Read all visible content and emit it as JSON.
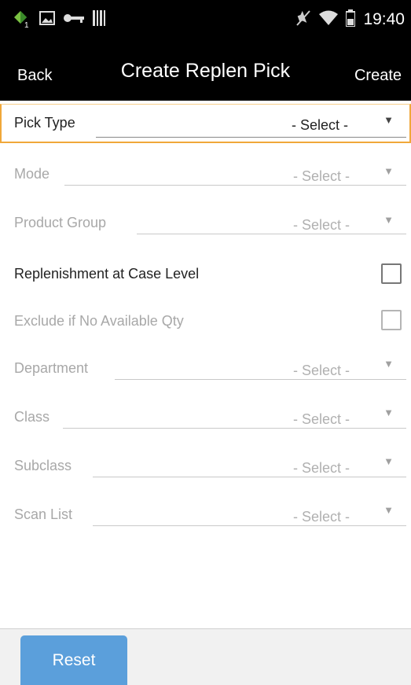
{
  "status_bar": {
    "time": "19:40",
    "icons": [
      "app-notification-icon",
      "image-icon",
      "key-icon",
      "barcode-icon",
      "mute-icon",
      "wifi-icon",
      "battery-icon"
    ],
    "notification_badge": "1"
  },
  "header": {
    "back_label": "Back",
    "title": "Create Replen Pick",
    "create_label": "Create"
  },
  "form": {
    "fields": [
      {
        "label": "Pick Type",
        "value": "- Select -",
        "enabled": true,
        "focused": true,
        "kind": "select"
      },
      {
        "label": "Mode",
        "value": "- Select -",
        "enabled": false,
        "kind": "select"
      },
      {
        "label": "Product Group",
        "value": "- Select -",
        "enabled": false,
        "kind": "select"
      },
      {
        "label": "Replenishment at Case Level",
        "enabled": true,
        "kind": "checkbox",
        "checked": false
      },
      {
        "label": "Exclude if No Available Qty",
        "enabled": false,
        "kind": "checkbox",
        "checked": false
      },
      {
        "label": "Department",
        "value": "- Select -",
        "enabled": false,
        "kind": "select"
      },
      {
        "label": "Class",
        "value": "- Select -",
        "enabled": false,
        "kind": "select"
      },
      {
        "label": "Subclass",
        "value": "- Select -",
        "enabled": false,
        "kind": "select"
      },
      {
        "label": "Scan List",
        "value": "- Select -",
        "enabled": false,
        "kind": "select"
      }
    ]
  },
  "footer": {
    "reset_label": "Reset"
  },
  "colors": {
    "accent": "#5b9fdb",
    "focus_border": "#f0a83a",
    "bar_background": "#000000"
  }
}
